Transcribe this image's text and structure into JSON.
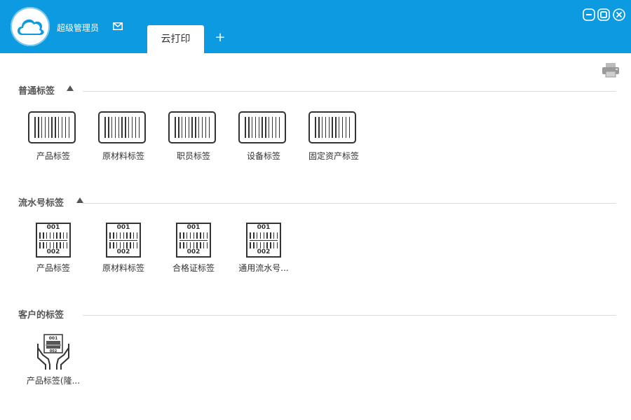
{
  "header": {
    "username": "超级管理员",
    "active_tab": "云打印",
    "add_tab": "+"
  },
  "sections": [
    {
      "title": "普通标签",
      "items": [
        "产品标签",
        "原材料标签",
        "职员标签",
        "设备标签",
        "固定资产标签"
      ]
    },
    {
      "title": "流水号标签",
      "items": [
        "产品标签",
        "原材料标签",
        "合格证标签",
        "通用流水号..."
      ],
      "serial_top": "001",
      "serial_bottom": "002"
    },
    {
      "title": "客户的标签",
      "items": [
        "产品标签(隆..."
      ]
    }
  ],
  "icons": {
    "logo": "cloud-logo-icon",
    "mail": "mail-icon",
    "minimize": "minimize-icon",
    "maximize": "maximize-icon",
    "close": "close-icon",
    "printer": "printer-icon"
  },
  "colors": {
    "titlebar": "#0c9ae0",
    "text": "#333333"
  }
}
